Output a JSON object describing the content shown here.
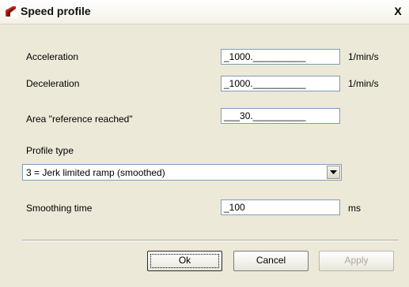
{
  "window": {
    "title": "Speed profile",
    "close_symbol": "X"
  },
  "form": {
    "acceleration": {
      "label": "Acceleration",
      "value": "_1000.__________",
      "unit": "1/min/s"
    },
    "deceleration": {
      "label": "Deceleration",
      "value": "_1000.__________",
      "unit": "1/min/s"
    },
    "area_reached": {
      "label": "Area \"reference reached\"",
      "value": "___30.__________"
    },
    "profile_type": {
      "label": "Profile type",
      "selected": "3 = Jerk limited ramp (smoothed)"
    },
    "smoothing_time": {
      "label": "Smoothing time",
      "value": "_100",
      "unit": "ms"
    }
  },
  "buttons": {
    "ok": "Ok",
    "cancel": "Cancel",
    "apply": "Apply"
  },
  "icons": {
    "app": "speed-profile-app-icon",
    "close": "close-icon",
    "dropdown": "chevron-down-icon"
  },
  "colors": {
    "dialog_bg": "#ece9d8",
    "field_border": "#7f9db9",
    "icon_red": "#c0271f"
  }
}
